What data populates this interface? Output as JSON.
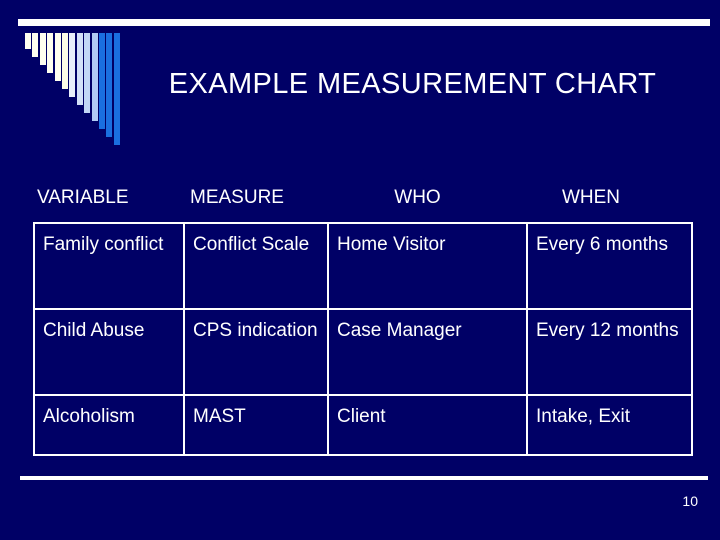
{
  "slide": {
    "background_color": "#000066",
    "text_color": "#ffffff",
    "title": "EXAMPLE MEASUREMENT CHART",
    "page_number": "10"
  },
  "decoration": {
    "top_rule_color": "#ffffff",
    "bottom_rule_color": "#ffffff",
    "bar_motif": {
      "count": 13,
      "colors": [
        "#fffff0",
        "#fffff0",
        "#fffff0",
        "#fffff0",
        "#fffff0",
        "#fdfde8",
        "#e8eefb",
        "#d3e0f8",
        "#c2d6f6",
        "#b2ccf4",
        "#1a6fe0",
        "#1a6fe0",
        "#1a6fe0"
      ],
      "heights": [
        16,
        24,
        32,
        40,
        48,
        56,
        64,
        72,
        80,
        88,
        96,
        104,
        112
      ]
    }
  },
  "table": {
    "headers": [
      "VARIABLE",
      "MEASURE",
      "WHO",
      "WHEN"
    ],
    "rows": [
      {
        "variable": "Family conflict",
        "measure": "Conflict Scale",
        "who": "Home Visitor",
        "when": "Every 6 months"
      },
      {
        "variable": "Child Abuse",
        "measure": "CPS indication",
        "who": "Case Manager",
        "when": "Every 12 months"
      },
      {
        "variable": "Alcoholism",
        "measure": "MAST",
        "who": "Client",
        "when": "Intake, Exit"
      }
    ]
  }
}
